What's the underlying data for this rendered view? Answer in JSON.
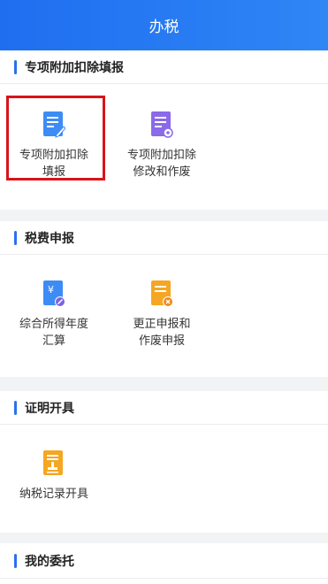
{
  "header": {
    "title": "办税"
  },
  "sections": [
    {
      "title": "专项附加扣除填报",
      "items": [
        {
          "label_line1": "专项附加扣除",
          "label_line2": "填报",
          "icon": "form-edit-icon",
          "color": "#3d8cf5"
        },
        {
          "label_line1": "专项附加扣除",
          "label_line2": "修改和作废",
          "icon": "form-settings-icon",
          "color": "#8a6ae8"
        }
      ]
    },
    {
      "title": "税费申报",
      "items": [
        {
          "label_line1": "综合所得年度",
          "label_line2": "汇算",
          "icon": "yuan-document-icon",
          "color": "#3d8cf5"
        },
        {
          "label_line1": "更正申报和",
          "label_line2": "作废申报",
          "icon": "document-cancel-icon",
          "color": "#f5a623"
        }
      ]
    },
    {
      "title": "证明开具",
      "items": [
        {
          "label_line1": "纳税记录开具",
          "label_line2": "",
          "icon": "stamp-document-icon",
          "color": "#f5a623"
        }
      ]
    },
    {
      "title": "我的委托",
      "items": []
    }
  ],
  "colors": {
    "header": "#2a7cf3",
    "accent": "#2b6ff0",
    "highlight": "#d8141a"
  }
}
